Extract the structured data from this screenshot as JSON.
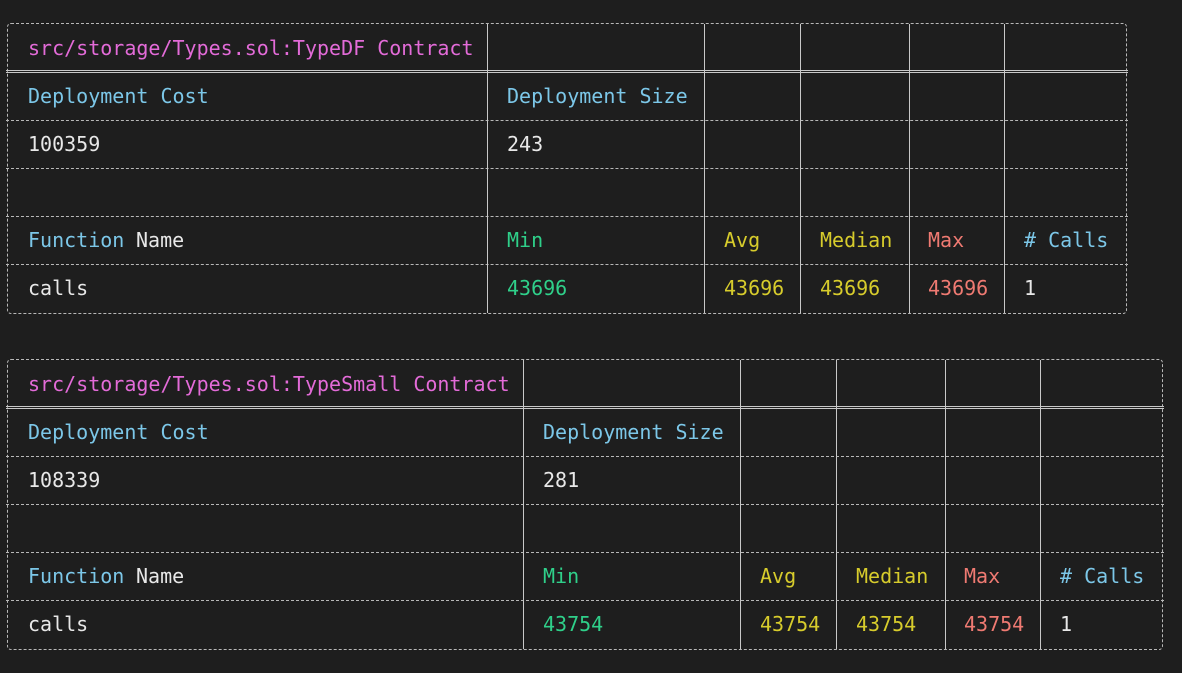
{
  "tables": [
    {
      "title": "src/storage/Types.sol:TypeDF Contract",
      "deployment_cost_label": "Deployment Cost",
      "deployment_size_label": "Deployment Size",
      "deployment_cost": "100359",
      "deployment_size": "243",
      "function_label": "Function",
      "name_label": "Name",
      "min_label": "Min",
      "avg_label": "Avg",
      "median_label": "Median",
      "max_label": "Max",
      "calls_label": "# Calls",
      "rows": [
        {
          "name": "calls",
          "min": "43696",
          "avg": "43696",
          "median": "43696",
          "max": "43696",
          "calls": "1"
        }
      ]
    },
    {
      "title": "src/storage/Types.sol:TypeSmall Contract",
      "deployment_cost_label": "Deployment Cost",
      "deployment_size_label": "Deployment Size",
      "deployment_cost": "108339",
      "deployment_size": "281",
      "function_label": "Function",
      "name_label": "Name",
      "min_label": "Min",
      "avg_label": "Avg",
      "median_label": "Median",
      "max_label": "Max",
      "calls_label": "# Calls",
      "rows": [
        {
          "name": "calls",
          "min": "43754",
          "avg": "43754",
          "median": "43754",
          "max": "43754",
          "calls": "1"
        }
      ]
    }
  ],
  "colors": {
    "background": "#1e1e1e",
    "title": "#e36bd8",
    "header": "#7cc7e8",
    "min": "#2fd08a",
    "avg_median": "#d7cc2c",
    "max": "#ef7a72"
  }
}
